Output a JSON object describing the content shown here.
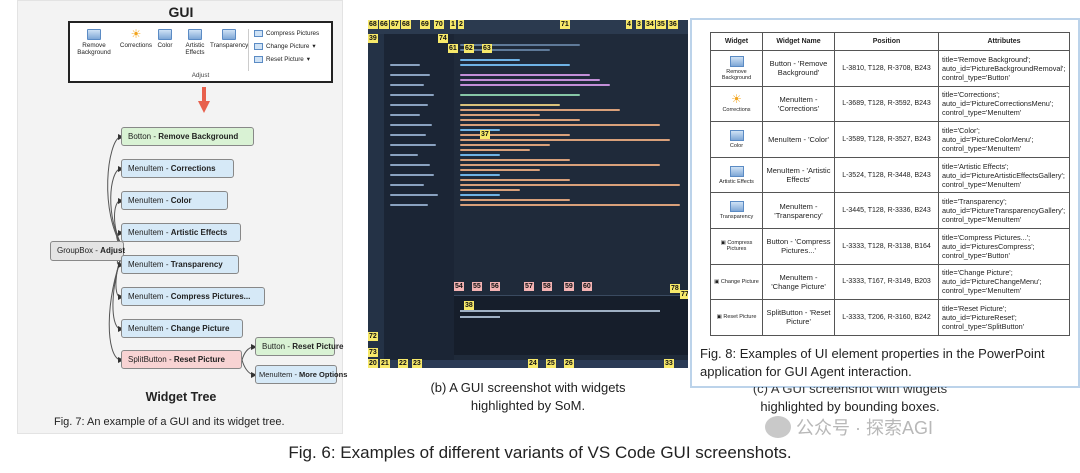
{
  "panel_a": {
    "gui_title": "GUI",
    "ribbon": {
      "items": [
        "Remove Background",
        "Corrections",
        "Color",
        "Artistic Effects",
        "Transparency"
      ],
      "right_items": [
        "Compress Pictures",
        "Change Picture",
        "Reset Picture"
      ],
      "group_label": "Adjust"
    },
    "groupbox": {
      "type": "GroupBox",
      "name": "Adjust"
    },
    "nodes": [
      {
        "type": "Botton",
        "name": "Remove Background"
      },
      {
        "type": "MenuItem",
        "name": "Corrections"
      },
      {
        "type": "MenuItem",
        "name": "Color"
      },
      {
        "type": "MenuItem",
        "name": "Artistic Effects"
      },
      {
        "type": "MenuItem",
        "name": "Transparency"
      },
      {
        "type": "MenuItem",
        "name": "Compress Pictures..."
      },
      {
        "type": "MenuItem",
        "name": "Change Picture"
      },
      {
        "type": "SplitButton",
        "name": "Reset Picture"
      },
      {
        "type": "Button",
        "name": "Reset Picture"
      },
      {
        "type": "MenuItem",
        "name": "More Options"
      }
    ],
    "separator": "-",
    "tree_caption": "Widget Tree",
    "figure_caption": "Fig. 7: An example of a GUI and its widget tree."
  },
  "panel_b": {
    "caption_line1": "(b) A GUI screenshot with widgets",
    "caption_line2": "highlighted by SoM.",
    "som_labels": [
      "68",
      "66",
      "67",
      "68",
      "69",
      "70",
      "1",
      "2",
      "71",
      "4",
      "3",
      "34",
      "35",
      "36",
      "39",
      "74",
      "61",
      "62",
      "63",
      "37",
      "78",
      "38",
      "77",
      "54",
      "55",
      "56",
      "57",
      "58",
      "59",
      "60",
      "72",
      "73",
      "20",
      "21",
      "22",
      "23",
      "24",
      "25",
      "26",
      "33"
    ]
  },
  "panel_c": {
    "headers": [
      "Widget",
      "Widget Name",
      "Position",
      "Attributes"
    ],
    "rows": [
      {
        "icon_label": "Remove Background",
        "name": "Button - 'Remove Background'",
        "position": "L-3810, T128, R-3708, B243",
        "attributes": "title='Remove Background'; auto_id='PictureBackgroundRemoval'; control_type='Button'"
      },
      {
        "icon_label": "Corrections",
        "name": "MenuItem - 'Corrections'",
        "position": "L-3689, T128, R-3592, B243",
        "attributes": "title='Corrections'; auto_id='PictureCorrectionsMenu'; control_type='MenuItem'"
      },
      {
        "icon_label": "Color",
        "name": "MenuItem - 'Color'",
        "position": "L-3589, T128, R-3527, B243",
        "attributes": "title='Color'; auto_id='PictureColorMenu'; control_type='MenuItem'"
      },
      {
        "icon_label": "Artistic Effects",
        "name": "MenuItem - 'Artistic Effects'",
        "position": "L-3524, T128, R-3448, B243",
        "attributes": "title='Artistic Effects'; auto_id='PictureArtisticEffectsGallery'; control_type='MenuItem'"
      },
      {
        "icon_label": "Transparency",
        "name": "MenuItem - 'Transparency'",
        "position": "L-3445, T128, R-3336, B243",
        "attributes": "title='Transparency'; auto_id='PictureTransparencyGallery'; control_type='MenuItem'"
      },
      {
        "icon_label": "Compress Pictures",
        "name": "Button - 'Compress Pictures...'",
        "position": "L-3333, T128, R-3138, B164",
        "attributes": "title='Compress Pictures...'; auto_id='PicturesCompress'; control_type='Button'"
      },
      {
        "icon_label": "Change Picture",
        "name": "MenuItem - 'Change Picture'",
        "position": "L-3333, T167, R-3149, B203",
        "attributes": "title='Change Picture'; auto_id='PictureChangeMenu'; control_type='MenuItem'"
      },
      {
        "icon_label": "Reset Picture",
        "name": "SplitButton - 'Reset Picture'",
        "position": "L-3333, T206, R-3160, B242",
        "attributes": "title='Reset Picture'; auto_id='PictureReset'; control_type='SplitButton'"
      }
    ],
    "figure_caption_line1": "Fig. 8: Examples of UI element properties in the PowerPoint",
    "figure_caption_line2": "application for GUI Agent interaction.",
    "caption_line1": "(c) A GUI screenshot with widgets",
    "caption_line2": "highlighted by bounding boxes."
  },
  "figure_caption": "Fig. 6: Examples of different variants of VS Code GUI screenshots.",
  "watermark": "公众号 · 探索AGI",
  "colors": {
    "node_blue": "#d6e9f7",
    "node_green": "#d9f2d4",
    "node_red": "#f8d3d3",
    "arrow": "#e8604c",
    "vscode_bg": "#1f2a3a",
    "som_label": "#f7e96a"
  }
}
